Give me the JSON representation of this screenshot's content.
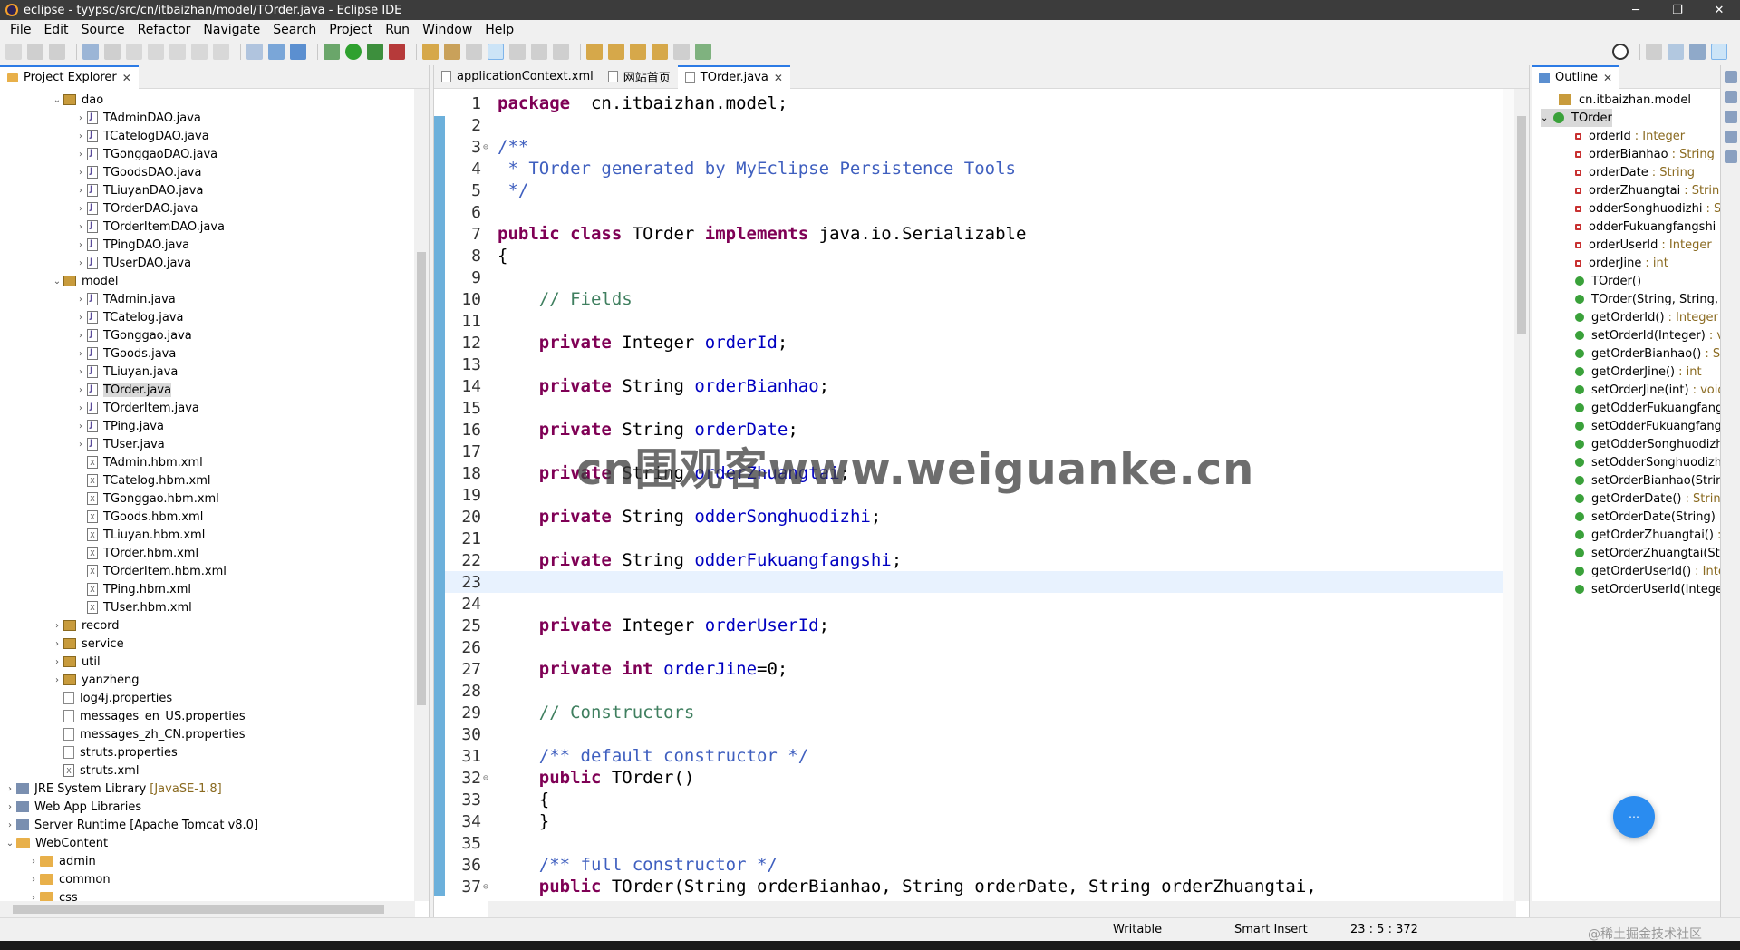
{
  "window": {
    "title": "eclipse - tyypsc/src/cn/itbaizhan/model/TOrder.java - Eclipse IDE",
    "min": "─",
    "max": "❐",
    "close": "✕"
  },
  "menu": [
    "File",
    "Edit",
    "Source",
    "Refactor",
    "Navigate",
    "Search",
    "Project",
    "Run",
    "Window",
    "Help"
  ],
  "explorer": {
    "tab_label": "Project Explorer",
    "rows": [
      {
        "indent": 3,
        "tw": "v",
        "icon": "pkg",
        "label": "dao"
      },
      {
        "indent": 4,
        "tw": ">",
        "icon": "java",
        "label": "TAdminDAO.java"
      },
      {
        "indent": 4,
        "tw": ">",
        "icon": "java",
        "label": "TCatelogDAO.java"
      },
      {
        "indent": 4,
        "tw": ">",
        "icon": "java",
        "label": "TGonggaoDAO.java"
      },
      {
        "indent": 4,
        "tw": ">",
        "icon": "java",
        "label": "TGoodsDAO.java"
      },
      {
        "indent": 4,
        "tw": ">",
        "icon": "java",
        "label": "TLiuyanDAO.java"
      },
      {
        "indent": 4,
        "tw": ">",
        "icon": "java",
        "label": "TOrderDAO.java"
      },
      {
        "indent": 4,
        "tw": ">",
        "icon": "java",
        "label": "TOrderItemDAO.java"
      },
      {
        "indent": 4,
        "tw": ">",
        "icon": "java",
        "label": "TPingDAO.java"
      },
      {
        "indent": 4,
        "tw": ">",
        "icon": "java",
        "label": "TUserDAO.java"
      },
      {
        "indent": 3,
        "tw": "v",
        "icon": "pkg",
        "label": "model"
      },
      {
        "indent": 4,
        "tw": ">",
        "icon": "java",
        "label": "TAdmin.java"
      },
      {
        "indent": 4,
        "tw": ">",
        "icon": "java",
        "label": "TCatelog.java"
      },
      {
        "indent": 4,
        "tw": ">",
        "icon": "java",
        "label": "TGonggao.java"
      },
      {
        "indent": 4,
        "tw": ">",
        "icon": "java",
        "label": "TGoods.java"
      },
      {
        "indent": 4,
        "tw": ">",
        "icon": "java",
        "label": "TLiuyan.java"
      },
      {
        "indent": 4,
        "tw": ">",
        "icon": "java",
        "label": "TOrder.java",
        "selected": true
      },
      {
        "indent": 4,
        "tw": ">",
        "icon": "java",
        "label": "TOrderItem.java"
      },
      {
        "indent": 4,
        "tw": ">",
        "icon": "java",
        "label": "TPing.java"
      },
      {
        "indent": 4,
        "tw": ">",
        "icon": "java",
        "label": "TUser.java"
      },
      {
        "indent": 4,
        "tw": "",
        "icon": "xml",
        "label": "TAdmin.hbm.xml"
      },
      {
        "indent": 4,
        "tw": "",
        "icon": "xml",
        "label": "TCatelog.hbm.xml"
      },
      {
        "indent": 4,
        "tw": "",
        "icon": "xml",
        "label": "TGonggao.hbm.xml"
      },
      {
        "indent": 4,
        "tw": "",
        "icon": "xml",
        "label": "TGoods.hbm.xml"
      },
      {
        "indent": 4,
        "tw": "",
        "icon": "xml",
        "label": "TLiuyan.hbm.xml"
      },
      {
        "indent": 4,
        "tw": "",
        "icon": "xml",
        "label": "TOrder.hbm.xml"
      },
      {
        "indent": 4,
        "tw": "",
        "icon": "xml",
        "label": "TOrderItem.hbm.xml"
      },
      {
        "indent": 4,
        "tw": "",
        "icon": "xml",
        "label": "TPing.hbm.xml"
      },
      {
        "indent": 4,
        "tw": "",
        "icon": "xml",
        "label": "TUser.hbm.xml"
      },
      {
        "indent": 3,
        "tw": ">",
        "icon": "pkg",
        "label": "record"
      },
      {
        "indent": 3,
        "tw": ">",
        "icon": "pkg",
        "label": "service"
      },
      {
        "indent": 3,
        "tw": ">",
        "icon": "pkg",
        "label": "util"
      },
      {
        "indent": 3,
        "tw": ">",
        "icon": "pkg",
        "label": "yanzheng"
      },
      {
        "indent": 3,
        "tw": "",
        "icon": "prop",
        "label": "log4j.properties"
      },
      {
        "indent": 3,
        "tw": "",
        "icon": "prop",
        "label": "messages_en_US.properties"
      },
      {
        "indent": 3,
        "tw": "",
        "icon": "prop",
        "label": "messages_zh_CN.properties"
      },
      {
        "indent": 3,
        "tw": "",
        "icon": "prop",
        "label": "struts.properties"
      },
      {
        "indent": 3,
        "tw": "",
        "icon": "xml",
        "label": "struts.xml"
      },
      {
        "indent": 1,
        "tw": ">",
        "icon": "lib",
        "label": "JRE System Library",
        "suffix": "[JavaSE-1.8]"
      },
      {
        "indent": 1,
        "tw": ">",
        "icon": "lib",
        "label": "Web App Libraries"
      },
      {
        "indent": 1,
        "tw": ">",
        "icon": "lib",
        "label": "Server Runtime [Apache Tomcat v8.0]"
      },
      {
        "indent": 1,
        "tw": "v",
        "icon": "folder",
        "label": "WebContent"
      },
      {
        "indent": 2,
        "tw": ">",
        "icon": "folder",
        "label": "admin"
      },
      {
        "indent": 2,
        "tw": ">",
        "icon": "folder",
        "label": "common"
      },
      {
        "indent": 2,
        "tw": ">",
        "icon": "folder",
        "label": "css"
      }
    ]
  },
  "editor": {
    "tabs": [
      {
        "label": "applicationContext.xml",
        "active": false
      },
      {
        "label": "网站首页",
        "active": false
      },
      {
        "label": "TOrder.java",
        "active": true
      }
    ],
    "current_line": 23,
    "lines": [
      {
        "n": "1",
        "parts": [
          [
            "kw",
            "package"
          ],
          [
            "",
            "  cn.itbaizhan.model;"
          ]
        ]
      },
      {
        "n": "2",
        "parts": []
      },
      {
        "n": "3",
        "fold": "⊖",
        "parts": [
          [
            "jd",
            "/**"
          ]
        ]
      },
      {
        "n": "4",
        "parts": [
          [
            "jd",
            " * TOrder generated by MyEclipse Persistence Tools"
          ]
        ]
      },
      {
        "n": "5",
        "parts": [
          [
            "jd",
            " */"
          ]
        ]
      },
      {
        "n": "6",
        "parts": []
      },
      {
        "n": "7",
        "parts": [
          [
            "kw",
            "public class"
          ],
          [
            "",
            " TOrder "
          ],
          [
            "kw",
            "implements"
          ],
          [
            "",
            " java.io.Serializable"
          ]
        ]
      },
      {
        "n": "8",
        "parts": [
          [
            "",
            "{"
          ]
        ]
      },
      {
        "n": "9",
        "parts": []
      },
      {
        "n": "10",
        "parts": [
          [
            "",
            "    "
          ],
          [
            "cm",
            "// Fields"
          ]
        ]
      },
      {
        "n": "11",
        "parts": []
      },
      {
        "n": "12",
        "parts": [
          [
            "",
            "    "
          ],
          [
            "kw",
            "private"
          ],
          [
            "",
            " Integer "
          ],
          [
            "fd",
            "orderId"
          ],
          [
            "",
            ";"
          ]
        ]
      },
      {
        "n": "13",
        "parts": []
      },
      {
        "n": "14",
        "parts": [
          [
            "",
            "    "
          ],
          [
            "kw",
            "private"
          ],
          [
            "",
            " String "
          ],
          [
            "fd",
            "orderBianhao"
          ],
          [
            "",
            ";"
          ]
        ]
      },
      {
        "n": "15",
        "parts": []
      },
      {
        "n": "16",
        "parts": [
          [
            "",
            "    "
          ],
          [
            "kw",
            "private"
          ],
          [
            "",
            " String "
          ],
          [
            "fd",
            "orderDate"
          ],
          [
            "",
            ";"
          ]
        ]
      },
      {
        "n": "17",
        "parts": []
      },
      {
        "n": "18",
        "parts": [
          [
            "",
            "    "
          ],
          [
            "kw",
            "private"
          ],
          [
            "",
            " String "
          ],
          [
            "fd",
            "orderZhuangtai"
          ],
          [
            "",
            ";"
          ]
        ]
      },
      {
        "n": "19",
        "parts": []
      },
      {
        "n": "20",
        "parts": [
          [
            "",
            "    "
          ],
          [
            "kw",
            "private"
          ],
          [
            "",
            " String "
          ],
          [
            "fd",
            "odderSonghuodizhi"
          ],
          [
            "",
            ";"
          ]
        ]
      },
      {
        "n": "21",
        "parts": []
      },
      {
        "n": "22",
        "parts": [
          [
            "",
            "    "
          ],
          [
            "kw",
            "private"
          ],
          [
            "",
            " String "
          ],
          [
            "fd",
            "odderFukuangfangshi"
          ],
          [
            "",
            ";"
          ]
        ]
      },
      {
        "n": "23",
        "parts": []
      },
      {
        "n": "24",
        "parts": []
      },
      {
        "n": "25",
        "parts": [
          [
            "",
            "    "
          ],
          [
            "kw",
            "private"
          ],
          [
            "",
            " Integer "
          ],
          [
            "fd",
            "orderUserId"
          ],
          [
            "",
            ";"
          ]
        ]
      },
      {
        "n": "26",
        "parts": []
      },
      {
        "n": "27",
        "parts": [
          [
            "",
            "    "
          ],
          [
            "kw",
            "private int"
          ],
          [
            "",
            " "
          ],
          [
            "fd",
            "orderJine"
          ],
          [
            "",
            "=0;"
          ]
        ]
      },
      {
        "n": "28",
        "parts": []
      },
      {
        "n": "29",
        "parts": [
          [
            "",
            "    "
          ],
          [
            "cm",
            "// Constructors"
          ]
        ]
      },
      {
        "n": "30",
        "parts": []
      },
      {
        "n": "31",
        "parts": [
          [
            "",
            "    "
          ],
          [
            "jd",
            "/** default constructor */"
          ]
        ]
      },
      {
        "n": "32",
        "fold": "⊖",
        "parts": [
          [
            "",
            "    "
          ],
          [
            "kw",
            "public"
          ],
          [
            "",
            " TOrder()"
          ]
        ]
      },
      {
        "n": "33",
        "parts": [
          [
            "",
            "    {"
          ]
        ]
      },
      {
        "n": "34",
        "parts": [
          [
            "",
            "    }"
          ]
        ]
      },
      {
        "n": "35",
        "parts": []
      },
      {
        "n": "36",
        "parts": [
          [
            "",
            "    "
          ],
          [
            "jd",
            "/** full constructor */"
          ]
        ]
      },
      {
        "n": "37",
        "fold": "⊖",
        "parts": [
          [
            "",
            "    "
          ],
          [
            "kw",
            "public"
          ],
          [
            "",
            " TOrder(String orderBianhao, String orderDate, String orderZhuangtai,"
          ]
        ]
      }
    ]
  },
  "outline": {
    "tab_label": "Outline",
    "package": "cn.itbaizhan.model",
    "class": "TOrder",
    "members": [
      {
        "kind": "field",
        "name": "orderId",
        "type": ": Integer"
      },
      {
        "kind": "field",
        "name": "orderBianhao",
        "type": ": String"
      },
      {
        "kind": "field",
        "name": "orderDate",
        "type": ": String"
      },
      {
        "kind": "field",
        "name": "orderZhuangtai",
        "type": ": String"
      },
      {
        "kind": "field",
        "name": "odderSonghuodizhi",
        "type": ": St"
      },
      {
        "kind": "field",
        "name": "odderFukuangfangshi",
        "type": ":"
      },
      {
        "kind": "field",
        "name": "orderUserId",
        "type": ": Integer"
      },
      {
        "kind": "field",
        "name": "orderJine",
        "type": ": int"
      },
      {
        "kind": "method",
        "name": "TOrder()",
        "type": ""
      },
      {
        "kind": "method",
        "name": "TOrder(String, String, S",
        "type": ""
      },
      {
        "kind": "method",
        "name": "getOrderId()",
        "type": ": Integer"
      },
      {
        "kind": "method",
        "name": "setOrderId(Integer)",
        "type": ": vo"
      },
      {
        "kind": "method",
        "name": "getOrderBianhao()",
        "type": ": Str"
      },
      {
        "kind": "method",
        "name": "getOrderJine()",
        "type": ": int"
      },
      {
        "kind": "method",
        "name": "setOrderJine(int)",
        "type": ": void"
      },
      {
        "kind": "method",
        "name": "getOdderFukuangfangs",
        "type": ""
      },
      {
        "kind": "method",
        "name": "setOdderFukuangfangs",
        "type": ""
      },
      {
        "kind": "method",
        "name": "getOdderSonghuodizhi",
        "type": ""
      },
      {
        "kind": "method",
        "name": "setOdderSonghuodizhi",
        "type": ""
      },
      {
        "kind": "method",
        "name": "setOrderBianhao(String",
        "type": ""
      },
      {
        "kind": "method",
        "name": "getOrderDate()",
        "type": ": String"
      },
      {
        "kind": "method",
        "name": "setOrderDate(String)",
        "type": ": v"
      },
      {
        "kind": "method",
        "name": "getOrderZhuangtai()",
        "type": ": S"
      },
      {
        "kind": "method",
        "name": "setOrderZhuangtai(Strin",
        "type": ""
      },
      {
        "kind": "method",
        "name": "getOrderUserId()",
        "type": ": Inte"
      },
      {
        "kind": "method",
        "name": "setOrderUserId(Integer",
        "type": ""
      }
    ]
  },
  "status": {
    "writable": "Writable",
    "insert_mode": "Smart Insert",
    "position": "23 : 5 : 372"
  },
  "watermark": "cn围观客www.weiguanke.cn",
  "credit": "@稀土掘金技术社区",
  "colors": {
    "accent": "#2c7be5",
    "keyword": "#7f0055",
    "comment": "#3f7f5f",
    "javadoc": "#3f5fbf",
    "field": "#0000c0"
  }
}
